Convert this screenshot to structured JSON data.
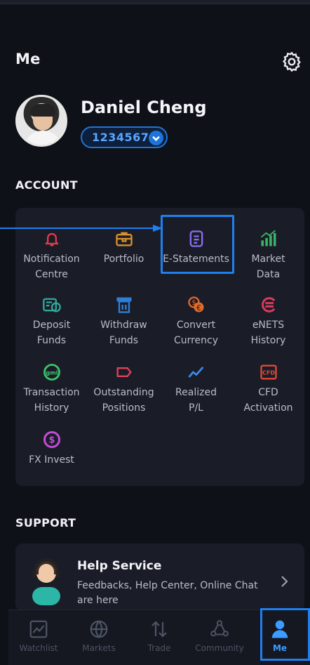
{
  "header": {
    "title": "Me"
  },
  "profile": {
    "name": "Daniel Cheng",
    "account_number": "1234567"
  },
  "sections": {
    "account": "ACCOUNT",
    "support": "SUPPORT"
  },
  "account_items": [
    {
      "label": "Notification\nCentre",
      "icon": "bell-icon",
      "color": "#e23a4a"
    },
    {
      "label": "Portfolio",
      "icon": "briefcase-icon",
      "color": "#d8912e"
    },
    {
      "label": "E-Statements",
      "icon": "document-icon",
      "color": "#8b6df2"
    },
    {
      "label": "Market\nData",
      "icon": "bar-chart-icon",
      "color": "#3bb36a"
    },
    {
      "label": "Deposit\nFunds",
      "icon": "deposit-icon",
      "color": "#2fa89a"
    },
    {
      "label": "Withdraw\nFunds",
      "icon": "withdraw-icon",
      "color": "#2f7fd8"
    },
    {
      "label": "Convert\nCurrency",
      "icon": "currency-convert-icon",
      "color": "#e36a2a"
    },
    {
      "label": "eNETS\nHistory",
      "icon": "enets-icon",
      "color": "#d83a5a"
    },
    {
      "label": "Transaction\nHistory",
      "icon": "transaction-icon",
      "color": "#3cc46a"
    },
    {
      "label": "Outstanding\nPositions",
      "icon": "tag-icon",
      "color": "#e2405a"
    },
    {
      "label": "Realized\nP/L",
      "icon": "trend-line-icon",
      "color": "#3a8ae8"
    },
    {
      "label": "CFD\nActivation",
      "icon": "cfd-icon",
      "color": "#e0483a"
    },
    {
      "label": "FX Invest",
      "icon": "fx-invest-icon",
      "color": "#c44ad8"
    }
  ],
  "support": {
    "title": "Help Service",
    "description": "Feedbacks, Help Center, Online Chat are here"
  },
  "tabs": [
    {
      "label": "Watchlist",
      "icon": "watchlist-chart-icon"
    },
    {
      "label": "Markets",
      "icon": "globe-icon"
    },
    {
      "label": "Trade",
      "icon": "trade-arrows-icon"
    },
    {
      "label": "Community",
      "icon": "community-icon"
    },
    {
      "label": "Me",
      "icon": "person-icon",
      "active": true
    }
  ],
  "colors": {
    "accent": "#1f7ff0",
    "background": "#0f1118",
    "panel": "#1a1d27"
  }
}
